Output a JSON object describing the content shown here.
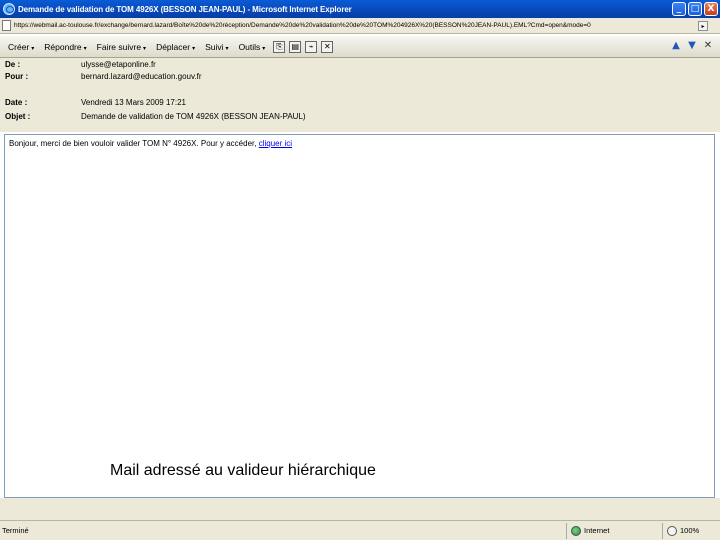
{
  "window": {
    "title": "Demande de validation de TOM 4926X (BESSON JEAN-PAUL) - Microsoft Internet Explorer",
    "buttons": {
      "minimize": "_",
      "maximize": "□",
      "close": "X"
    }
  },
  "address": {
    "url": "https://webmail.ac-toulouse.fr/exchange/bernard.lazard/Boîte%20de%20réception/Demande%20de%20validation%20de%20TOM%204926X%20(BESSON%20JEAN-PAUL).EML?Cmd=open&mode=0"
  },
  "toolbar": {
    "items": [
      "Créer",
      "Répondre",
      "Faire suivre",
      "Déplacer",
      "Suivi",
      "Outils"
    ]
  },
  "headers": {
    "from_label": "De :",
    "from_value": "ulysse@etaponline.fr",
    "to_label": "Pour :",
    "to_value": "bernard.lazard@education.gouv.fr",
    "date_label": "Date :",
    "date_value": "Vendredi 13 Mars 2009 17:21",
    "subject_label": "Objet :",
    "subject_value": "Demande de validation de TOM 4926X (BESSON JEAN-PAUL)"
  },
  "body": {
    "text": "Bonjour, merci de bien vouloir valider TOM N° 4926X. Pour y accéder,",
    "link": "cliquer ici"
  },
  "caption": "Mail adressé au valideur hiérarchique",
  "status": {
    "left": "Terminé",
    "zone": "Internet",
    "zoom": "100%"
  }
}
